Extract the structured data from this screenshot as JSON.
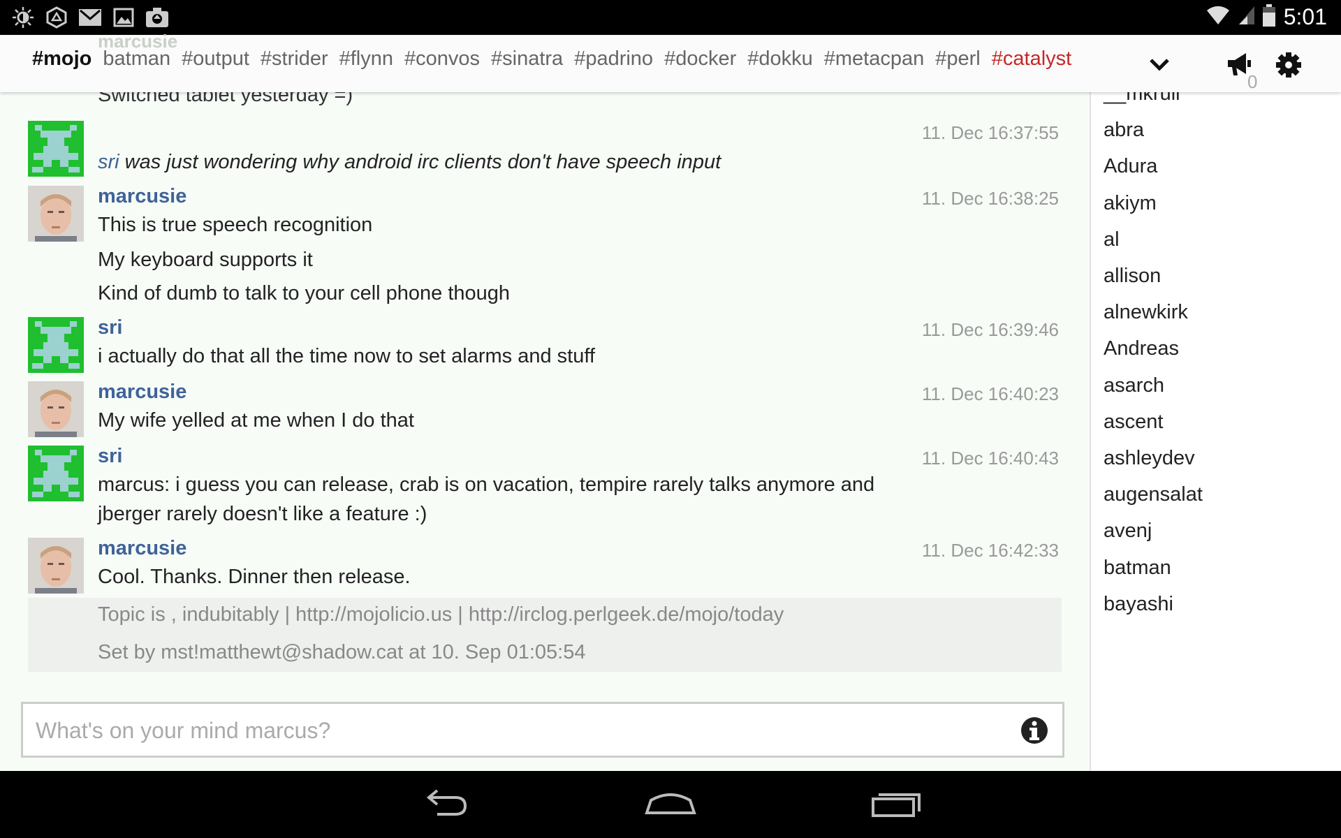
{
  "status_bar": {
    "time": "5:01",
    "left_icons": [
      "brightness-icon",
      "vpn-shield-icon",
      "gmail-icon",
      "image-icon",
      "camera-upload-icon"
    ],
    "right_icons": [
      "wifi-icon",
      "signal-icon",
      "battery-icon"
    ]
  },
  "header": {
    "ghost_text": "marcusie",
    "tabs": [
      "#mojo",
      "batman",
      "#output",
      "#strider",
      "#flynn",
      "#convos",
      "#sinatra",
      "#padrino",
      "#docker",
      "#dokku",
      "#metacpan",
      "#perl",
      "#catalyst"
    ],
    "active_tab": "#mojo",
    "alert_tab": "#catalyst",
    "notification_count": "0",
    "colors": {
      "active": "#111111",
      "alert": "#c62828",
      "inactive": "#666666"
    }
  },
  "messages": {
    "partial_line": "Switched tablet yesterday =)",
    "action": {
      "timestamp": "11. Dec 16:37:55",
      "nick": "sri",
      "text": " was just wondering why android irc clients don't have speech input"
    },
    "groups": [
      {
        "nick": "marcusie",
        "timestamp": "11. Dec 16:38:25",
        "lines": [
          "This is true speech recognition",
          "My keyboard supports it",
          "Kind of dumb to talk to your cell phone though"
        ]
      },
      {
        "nick": "sri",
        "timestamp": "11. Dec 16:39:46",
        "lines": [
          "i actually do that all the time now to set alarms and stuff"
        ]
      },
      {
        "nick": "marcusie",
        "timestamp": "11. Dec 16:40:23",
        "lines": [
          "My wife yelled at me when I do that"
        ]
      },
      {
        "nick": "sri",
        "timestamp": "11. Dec 16:40:43",
        "lines": [
          "marcus: i guess you can release, crab is on vacation, tempire rarely talks anymore and",
          "jberger rarely doesn't like a feature :)"
        ]
      },
      {
        "nick": "marcusie",
        "timestamp": "11. Dec 16:42:33",
        "lines": [
          "Cool. Thanks. Dinner then release."
        ]
      }
    ],
    "nick_color": "#3f6399"
  },
  "topic": {
    "line1": "Topic is  , indubitably | http://mojolicio.us | http://irclog.perlgeek.de/mojo/today",
    "line2": "Set by mst!matthewt@shadow.cat at 10. Sep 01:05:54"
  },
  "input": {
    "placeholder": "What's on your mind marcus?",
    "value": ""
  },
  "sidebar": {
    "users": [
      "__mkrull",
      "abra",
      "Adura",
      "akiym",
      "al",
      "allison",
      "alnewkirk",
      "Andreas",
      "asarch",
      "ascent",
      "ashleydev",
      "augensalat",
      "avenj",
      "batman",
      "bayashi"
    ]
  },
  "navbar": {
    "buttons": [
      "back-icon",
      "home-icon",
      "recents-icon"
    ]
  }
}
